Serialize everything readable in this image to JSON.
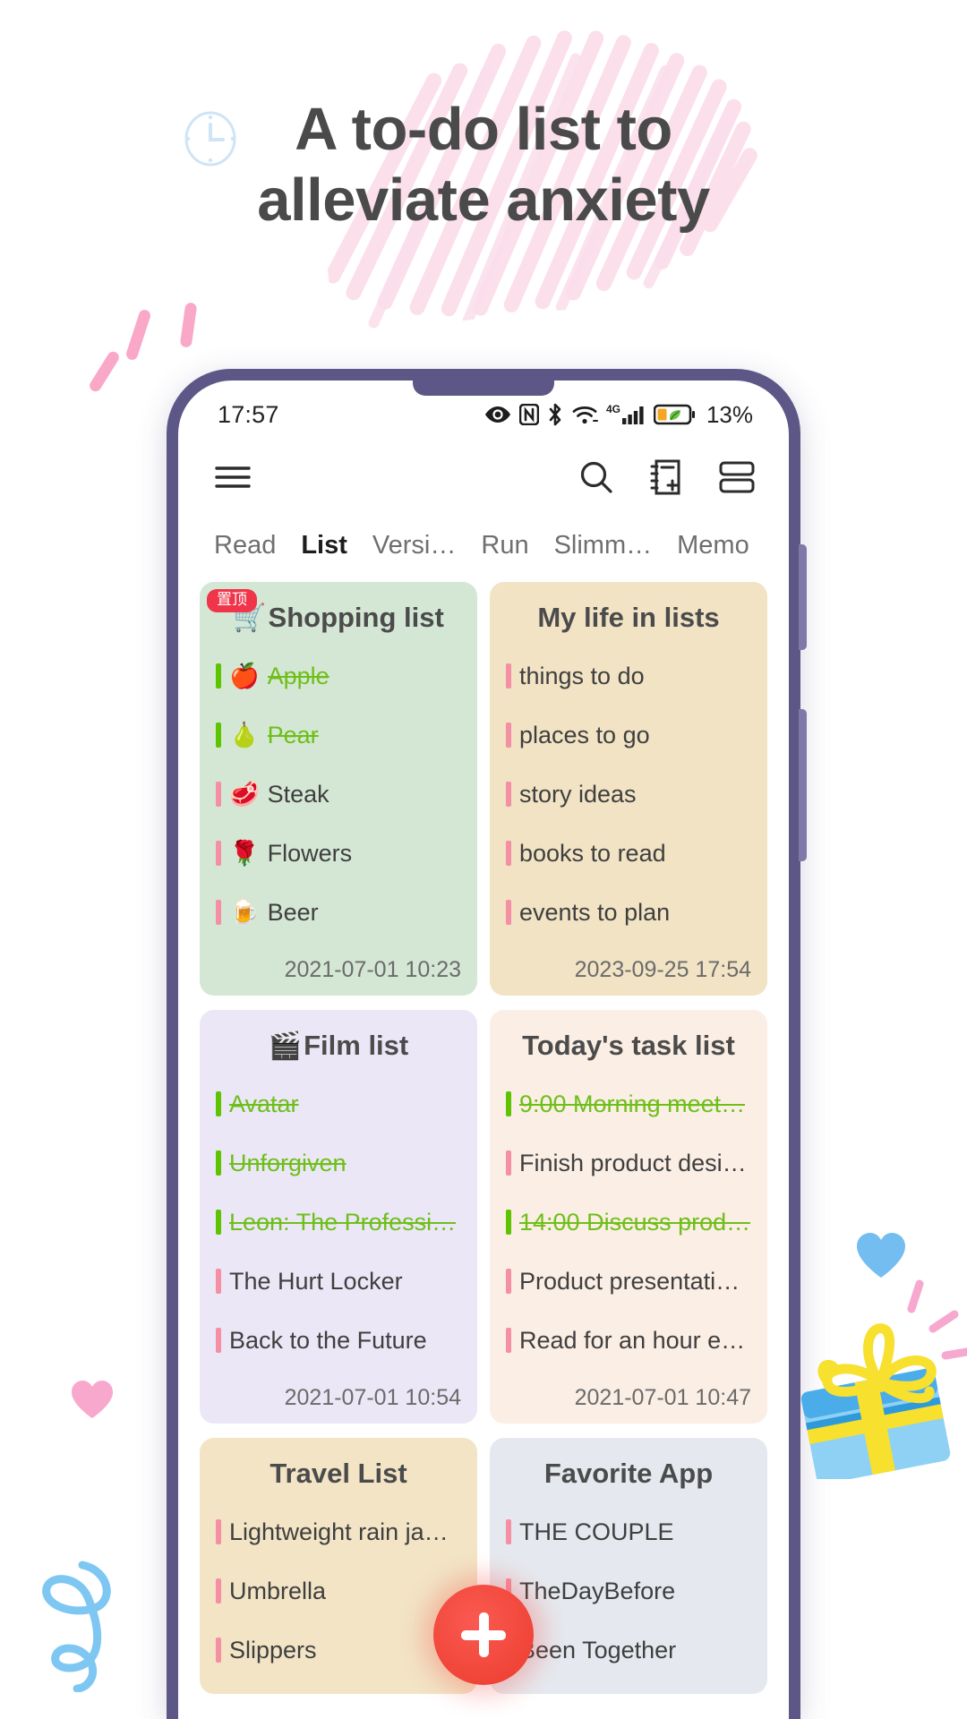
{
  "hero": {
    "headline_line1": "A to-do list to",
    "headline_line2": "alleviate anxiety",
    "clock_icon": "clock-icon"
  },
  "phone": {
    "statusbar": {
      "time": "17:57",
      "battery_percent": "13%",
      "icons": [
        "eye-icon",
        "nfc-icon",
        "bluetooth-icon",
        "wifi-icon",
        "4g-signal-icon",
        "battery-eco-icon"
      ],
      "network_label": "4G"
    },
    "app_header": {
      "menu_icon": "hamburger-menu-icon",
      "search_icon": "search-icon",
      "new_note_icon": "add-note-icon",
      "layout_icon": "layout-toggle-icon"
    },
    "tabs": [
      {
        "label": "Read",
        "active": false
      },
      {
        "label": "List",
        "active": true
      },
      {
        "label": "Versi…",
        "active": false
      },
      {
        "label": "Run",
        "active": false
      },
      {
        "label": "Slimm…",
        "active": false
      },
      {
        "label": "Memo",
        "active": false
      }
    ],
    "cards": [
      {
        "title": "Shopping list",
        "emoji": "🛒",
        "pinned_badge": "置顶",
        "bg": "#d4e7d4",
        "date": "2021-07-01 10:23",
        "items": [
          {
            "emoji": "🍎",
            "text": "Apple",
            "done": true
          },
          {
            "emoji": "🍐",
            "text": "Pear",
            "done": true
          },
          {
            "emoji": "🥩",
            "text": "Steak",
            "done": false
          },
          {
            "emoji": "🌹",
            "text": "Flowers",
            "done": false
          },
          {
            "emoji": "🍺",
            "text": "Beer",
            "done": false
          }
        ]
      },
      {
        "title": "My life in lists",
        "emoji": "",
        "pinned_badge": "",
        "bg": "#f1e3c4",
        "date": "2023-09-25 17:54",
        "items": [
          {
            "emoji": "",
            "text": "things to do",
            "done": false
          },
          {
            "emoji": "",
            "text": "places to go",
            "done": false
          },
          {
            "emoji": "",
            "text": "story ideas",
            "done": false
          },
          {
            "emoji": "",
            "text": "books to read",
            "done": false
          },
          {
            "emoji": "",
            "text": "events to plan",
            "done": false
          }
        ]
      },
      {
        "title": "Film list",
        "emoji": "🎬",
        "pinned_badge": "",
        "bg": "#ece7f7",
        "date": "2021-07-01 10:54",
        "items": [
          {
            "emoji": "",
            "text": "Avatar",
            "done": true
          },
          {
            "emoji": "",
            "text": "Unforgiven",
            "done": true
          },
          {
            "emoji": "",
            "text": "Leon: The Professi…",
            "done": true
          },
          {
            "emoji": "",
            "text": "The Hurt Locker",
            "done": false
          },
          {
            "emoji": "",
            "text": "Back to the Future",
            "done": false
          }
        ]
      },
      {
        "title": "Today's task list",
        "emoji": "",
        "pinned_badge": "",
        "bg": "#fbeee4",
        "date": "2021-07-01 10:47",
        "items": [
          {
            "emoji": "",
            "text": "9:00 Morning meet…",
            "done": true
          },
          {
            "emoji": "",
            "text": "Finish product desi…",
            "done": false
          },
          {
            "emoji": "",
            "text": "14:00 Discuss prod…",
            "done": true
          },
          {
            "emoji": "",
            "text": "Product presentati…",
            "done": false
          },
          {
            "emoji": "",
            "text": "Read for an hour e…",
            "done": false
          }
        ]
      },
      {
        "title": "Travel List",
        "emoji": "",
        "pinned_badge": "",
        "bg": "#f2e4c5",
        "date": "",
        "items": [
          {
            "emoji": "",
            "text": "Lightweight rain ja…",
            "done": false
          },
          {
            "emoji": "",
            "text": "Umbrella",
            "done": false
          },
          {
            "emoji": "",
            "text": "Slippers",
            "done": false
          }
        ]
      },
      {
        "title": "Favorite App",
        "emoji": "",
        "pinned_badge": "",
        "bg": "#e5e9ef",
        "date": "",
        "items": [
          {
            "emoji": "",
            "text": "THE COUPLE",
            "done": false
          },
          {
            "emoji": "",
            "text": "TheDayBefore",
            "done": false
          },
          {
            "emoji": "",
            "text": "Been Together",
            "done": false
          }
        ]
      }
    ],
    "fab": {
      "icon": "plus-icon",
      "color": "#f0453b"
    }
  },
  "decorations": {
    "gift_icon": "gift-box-icon",
    "blue_heart_icon": "heart-icon",
    "pink_heart_icon": "heart-icon",
    "squiggle_icon": "squiggle-icon",
    "colors": {
      "scribble_pink": "#fbdfeb",
      "phone_frame": "#5d5787",
      "accent_pink": "#f48fa4",
      "accent_green": "#6fbf1b",
      "tab_highlight": "#dff55c"
    }
  }
}
